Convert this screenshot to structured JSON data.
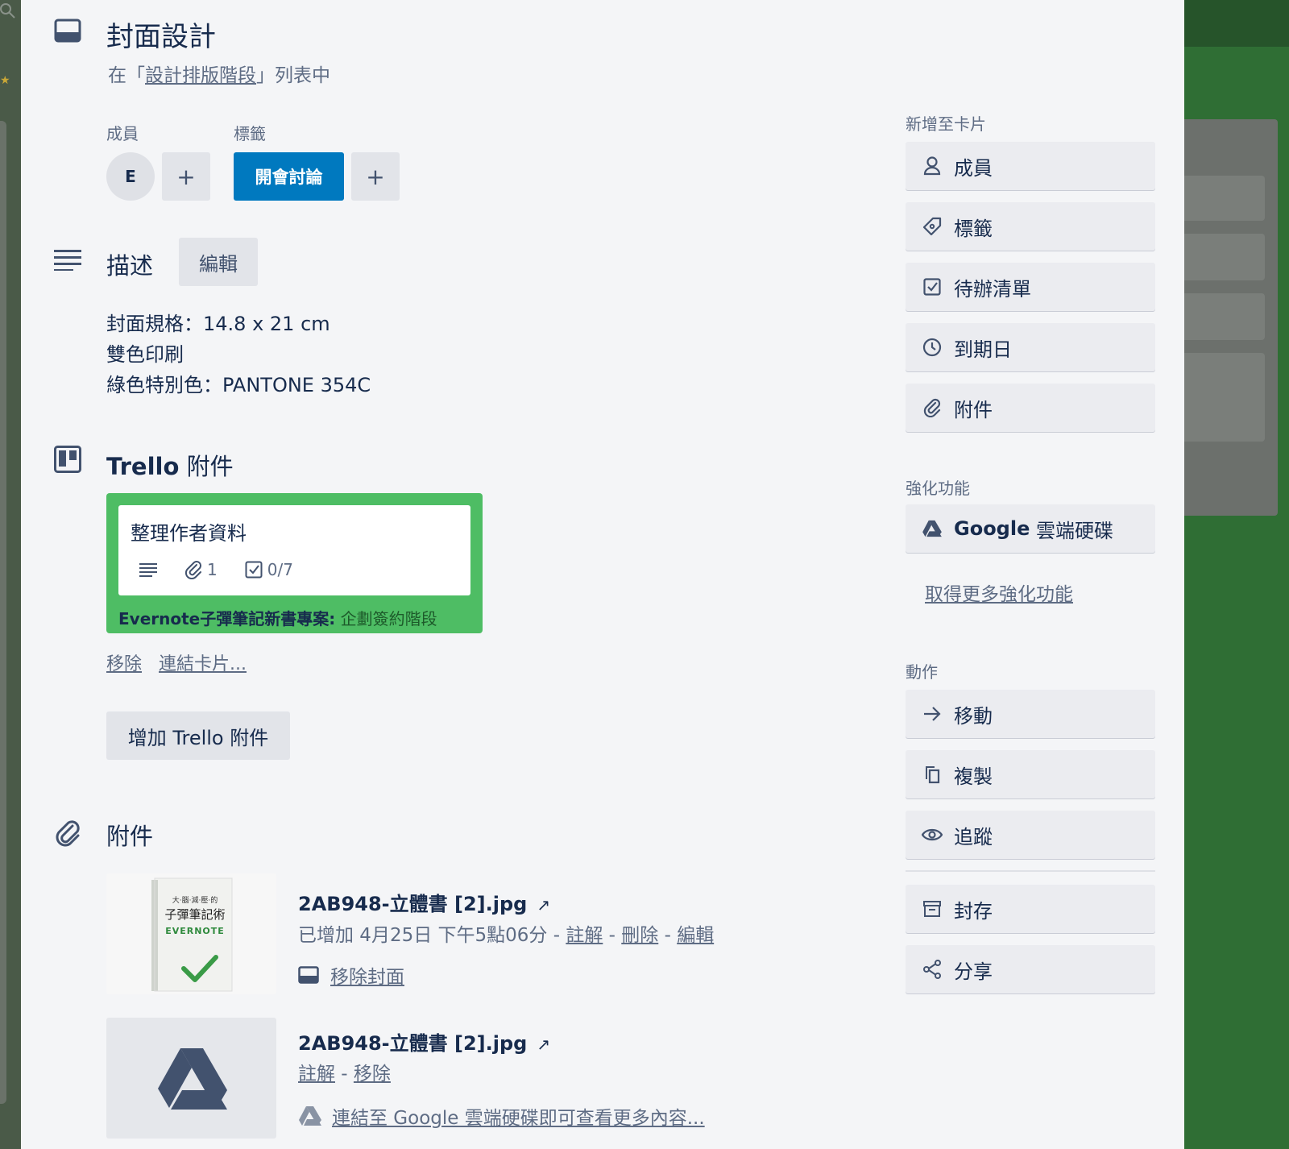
{
  "card": {
    "title": "封面設計",
    "in_list_prefix": "在「",
    "list_name": "設計排版階段",
    "in_list_suffix": "」列表中"
  },
  "members": {
    "label": "成員",
    "avatar_initial": "E",
    "add": "+"
  },
  "labels": {
    "label": "標籤",
    "items": [
      "開會討論"
    ],
    "label_color": "#0079bf",
    "add": "+"
  },
  "description": {
    "title": "描述",
    "edit_label": "編輯",
    "lines": [
      "封面規格：14.8 x 21 cm",
      "雙色印刷",
      "綠色特別色：PANTONE 354C"
    ]
  },
  "trello_attachments": {
    "title_bold": "Trello",
    "title_rest": " 附件",
    "card_title": "整理作者資料",
    "attachment_count": "1",
    "checklist": "0/7",
    "board_name": "Evernote子彈筆記新書專案:",
    "list_name": " 企劃簽約階段",
    "accent_color": "#4ebd64",
    "remove_link": "移除",
    "connect_link": "連結卡片...",
    "add_button": "增加 Trello 附件"
  },
  "attachments": {
    "title": "附件",
    "items": [
      {
        "name": "2AB948-立體書 [2].jpg",
        "arrow": "↗",
        "added": "已增加 4月25日 下午5點06分 - ",
        "comment": "註解",
        "sep1": " - ",
        "delete": "刪除",
        "sep2": " - ",
        "edit": "編輯",
        "cover_action": "移除封面",
        "thumb_text": {
          "top": "大‧腦‧減‧壓‧的",
          "main": "子彈筆記術",
          "brand": "EVERNOTE"
        }
      },
      {
        "name": "2AB948-立體書 [2].jpg",
        "arrow": "↗",
        "comment": "註解",
        "sep": " - ",
        "remove": "移除",
        "drive_link": "連結至 Google 雲端硬碟即可查看更多內容..."
      }
    ]
  },
  "sidebar": {
    "add_to_card_heading": "新增至卡片",
    "add_items": [
      "成員",
      "標籤",
      "待辦清單",
      "到期日",
      "附件"
    ],
    "powerups_heading": "強化功能",
    "powerup_bold": "Google",
    "powerup_rest": " 雲端硬碟",
    "more_powerups": "取得更多強化功能",
    "actions_heading": "動作",
    "action_items": [
      "移動",
      "複製",
      "追蹤"
    ],
    "extra_actions": [
      "封存",
      "分享"
    ]
  },
  "background": {
    "more": "···"
  }
}
